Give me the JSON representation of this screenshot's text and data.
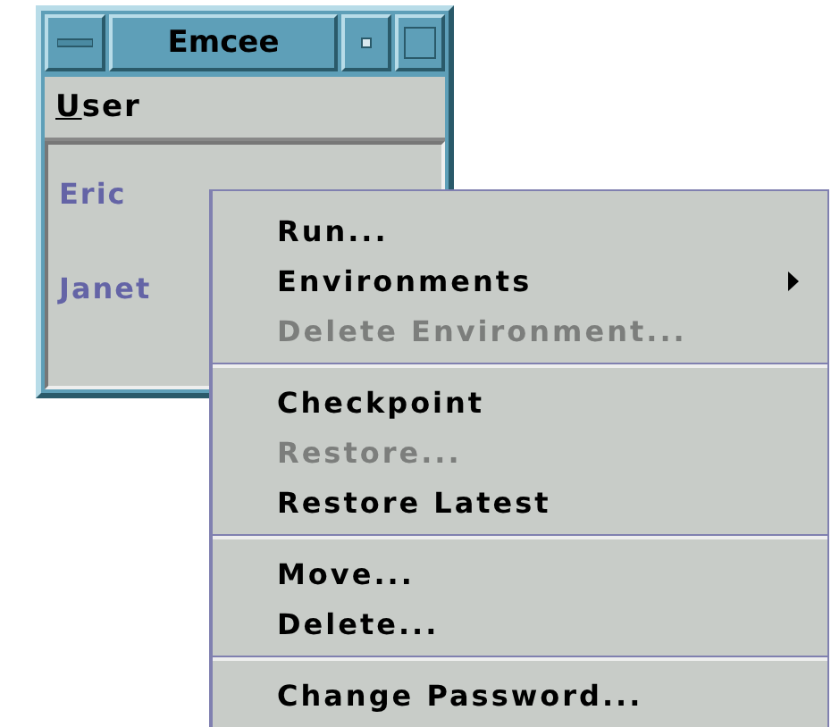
{
  "window": {
    "title": "Emcee"
  },
  "menu_bar": [
    {
      "label": "User",
      "underlined_first_letter": true
    }
  ],
  "list": [
    {
      "label": "Eric"
    },
    {
      "label": "Janet"
    }
  ],
  "context_menu": [
    {
      "kind": "item",
      "label": "Run...",
      "disabled": false,
      "submenu": false
    },
    {
      "kind": "item",
      "label": "Environments",
      "disabled": false,
      "submenu": true
    },
    {
      "kind": "item",
      "label": "Delete Environment...",
      "disabled": true,
      "submenu": false
    },
    {
      "kind": "separator"
    },
    {
      "kind": "item",
      "label": "Checkpoint",
      "disabled": false,
      "submenu": false
    },
    {
      "kind": "item",
      "label": "Restore...",
      "disabled": true,
      "submenu": false
    },
    {
      "kind": "item",
      "label": "Restore Latest",
      "disabled": false,
      "submenu": false
    },
    {
      "kind": "separator"
    },
    {
      "kind": "item",
      "label": "Move...",
      "disabled": false,
      "submenu": false
    },
    {
      "kind": "item",
      "label": "Delete...",
      "disabled": false,
      "submenu": false
    },
    {
      "kind": "separator"
    },
    {
      "kind": "item",
      "label": "Change Password...",
      "disabled": false,
      "submenu": false
    }
  ]
}
